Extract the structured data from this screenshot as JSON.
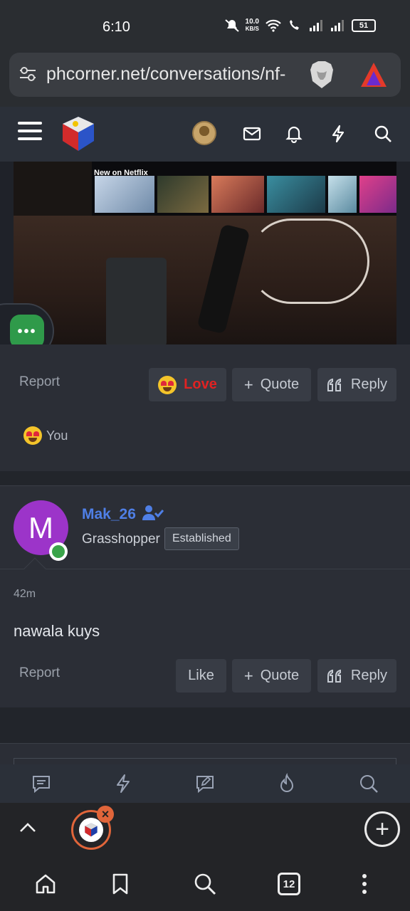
{
  "status": {
    "time": "6:10",
    "net_speed": "10.0",
    "net_unit": "KB/S",
    "battery": "51"
  },
  "browser": {
    "url": "phcorner.net/conversations/nf-",
    "tab_count": "12"
  },
  "photo": {
    "caption": "New on Netflix"
  },
  "post1": {
    "report": "Report",
    "love_label": "Love",
    "quote_label": "Quote",
    "reply_label": "Reply",
    "reaction_by": "You"
  },
  "post2": {
    "avatar_letter": "M",
    "username": "Mak_26",
    "user_title": "Grasshopper",
    "badge": "Established",
    "time": "42m",
    "message": "nawala kuys",
    "report": "Report",
    "like_label": "Like",
    "quote_label": "Quote",
    "reply_label": "Reply"
  },
  "fab": {
    "label": "•••"
  },
  "colors": {
    "love": "#e02222",
    "username": "#4f7fe6",
    "avatar_bg": "#9c34c9",
    "fab": "#2f9a4a",
    "tab_ring": "#e0653a"
  }
}
